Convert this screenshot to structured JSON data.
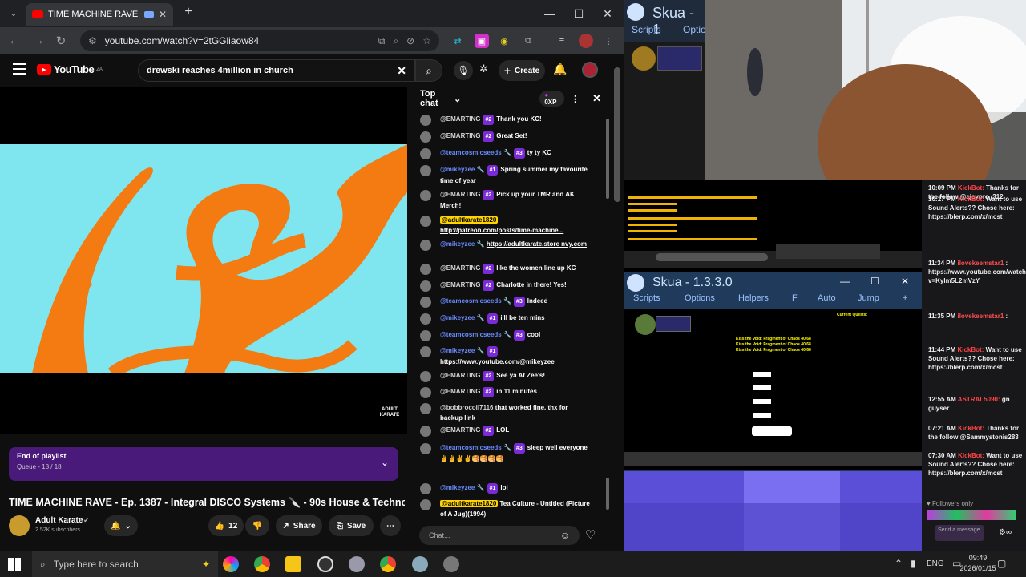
{
  "browser": {
    "tab_title": "TIME MACHINE RAVE - Ep.",
    "url": "youtube.com/watch?v=2tGGliaow84",
    "new_tab_label": "+"
  },
  "youtube": {
    "logo_text": "YouTube",
    "region": "ZA",
    "search_value": "drewski reaches 4million in church",
    "create_label": "Create",
    "playlist_title": "End of playlist",
    "playlist_queue": "Queue - 18 / 18",
    "video_title": "TIME MACHINE RAVE - Ep. 1387 - Integral DISCO Systems 🔪 - 90s House & Techno",
    "channel_name": "Adult Karate",
    "subscribers": "2.52K subscribers",
    "like_count": "12",
    "share_label": "Share",
    "save_label": "Save",
    "watermark": "ADULT KARATE"
  },
  "chat": {
    "mode": "Top chat",
    "xp_label": "0XP",
    "input_placeholder": "Chat...",
    "messages": [
      {
        "author": "@EMARTING",
        "badge": "#2",
        "text": "Thank you KC!"
      },
      {
        "author": "@EMARTING",
        "badge": "#2",
        "text": "Great Set!"
      },
      {
        "author": "@teamcosmicseeds 🔧",
        "badge": "#3",
        "text": "ty ty KC"
      },
      {
        "author": "@mikeyzee 🔧",
        "badge": "#1",
        "text": "Spring summer my favourite time of year"
      },
      {
        "author": "@EMARTING",
        "badge": "#2",
        "text": "Pick up your TMR and AK Merch!"
      },
      {
        "author": "@adultkarate1820",
        "badge": "",
        "text": "http://patreon.com/posts/time-machine..."
      },
      {
        "author": "@mikeyzee 🔧",
        "badge": "",
        "text": "https://adultkarate.store nvy.com"
      },
      {
        "author": "@EMARTING",
        "badge": "#2",
        "text": "like the women line up KC"
      },
      {
        "author": "@EMARTING",
        "badge": "#2",
        "text": "Charlotte in there! Yes!"
      },
      {
        "author": "@teamcosmicseeds 🔧",
        "badge": "#3",
        "text": "Indeed"
      },
      {
        "author": "@mikeyzee 🔧",
        "badge": "#1",
        "text": "i'll be ten mins"
      },
      {
        "author": "@teamcosmicseeds 🔧",
        "badge": "#3",
        "text": "cool"
      },
      {
        "author": "@mikeyzee 🔧",
        "badge": "#1",
        "text": "https://www.youtube.com/@mikeyzee"
      },
      {
        "author": "@EMARTING",
        "badge": "#2",
        "text": "See ya At Zee's!"
      },
      {
        "author": "@EMARTING",
        "badge": "#2",
        "text": "in 11 minutes"
      },
      {
        "author": "@bobbrocoli7116",
        "badge": "",
        "text": "that worked fine. thx for backup link"
      },
      {
        "author": "@EMARTING",
        "badge": "#2",
        "text": "LOL"
      },
      {
        "author": "@teamcosmicseeds 🔧",
        "badge": "#3",
        "text": "sleep well everyone ✌️✌️✌️✌️🥞🥞🥞🥞"
      },
      {
        "author": "@mikeyzee 🔧",
        "badge": "#1",
        "text": "lol"
      },
      {
        "author": "@adultkarate1820",
        "badge": "",
        "text": "Tea Culture - Untitled (Picture of A Jug)(1994)"
      }
    ]
  },
  "skua": {
    "title_top": "Skua - 1",
    "menu_top": [
      "Scripts",
      "Optio"
    ],
    "title": "Skua - 1.3.3.0",
    "menu": [
      "Scripts",
      "Options",
      "Helpers",
      "F",
      "Auto",
      "Jump",
      "+"
    ],
    "quest_lines": [
      "Kiss the Void: Fragment of Chaos 40/68",
      "Kiss the Void: Fragment of Chaos 40/68",
      "Kiss the Void: Fragment of Chaos 40/68"
    ],
    "current_quests": "Current Quests:"
  },
  "twitch": {
    "messages": [
      {
        "time": "10:09 PM",
        "user": "KickBot:",
        "text": "Thanks for the follow @ajeypro_312"
      },
      {
        "time": "10:17 PM",
        "user": "KickBot:",
        "text": "Want to use Sound Alerts?? Chose here: https://blerp.com/x/mcst"
      },
      {
        "time": "11:34 PM",
        "user": "ilovekeemstar1",
        "text": ": https://www.youtube.com/watch?v=Kylm5L2mVzY"
      },
      {
        "time": "11:35 PM",
        "user": "ilovekeemstar1",
        "text": ":"
      },
      {
        "time": "11:44 PM",
        "user": "KickBot:",
        "text": "Want to use Sound Alerts?? Chose here: https://blerp.com/x/mcst"
      },
      {
        "time": "12:55 AM",
        "user": "ASTRAL5090:",
        "text": "gn guyser"
      },
      {
        "time": "07:21 AM",
        "user": "KickBot:",
        "text": "Thanks for the follow @Sammystonis283"
      },
      {
        "time": "07:30 AM",
        "user": "KickBot:",
        "text": "Want to use Sound Alerts?? Chose here: https://blerp.com/x/mcst"
      }
    ],
    "followers_only": "Followers only",
    "send_label": "Send a message"
  },
  "taskbar": {
    "search_placeholder": "Type here to search",
    "lang": "ENG",
    "time": "09:49",
    "date": "2026/01/15"
  }
}
